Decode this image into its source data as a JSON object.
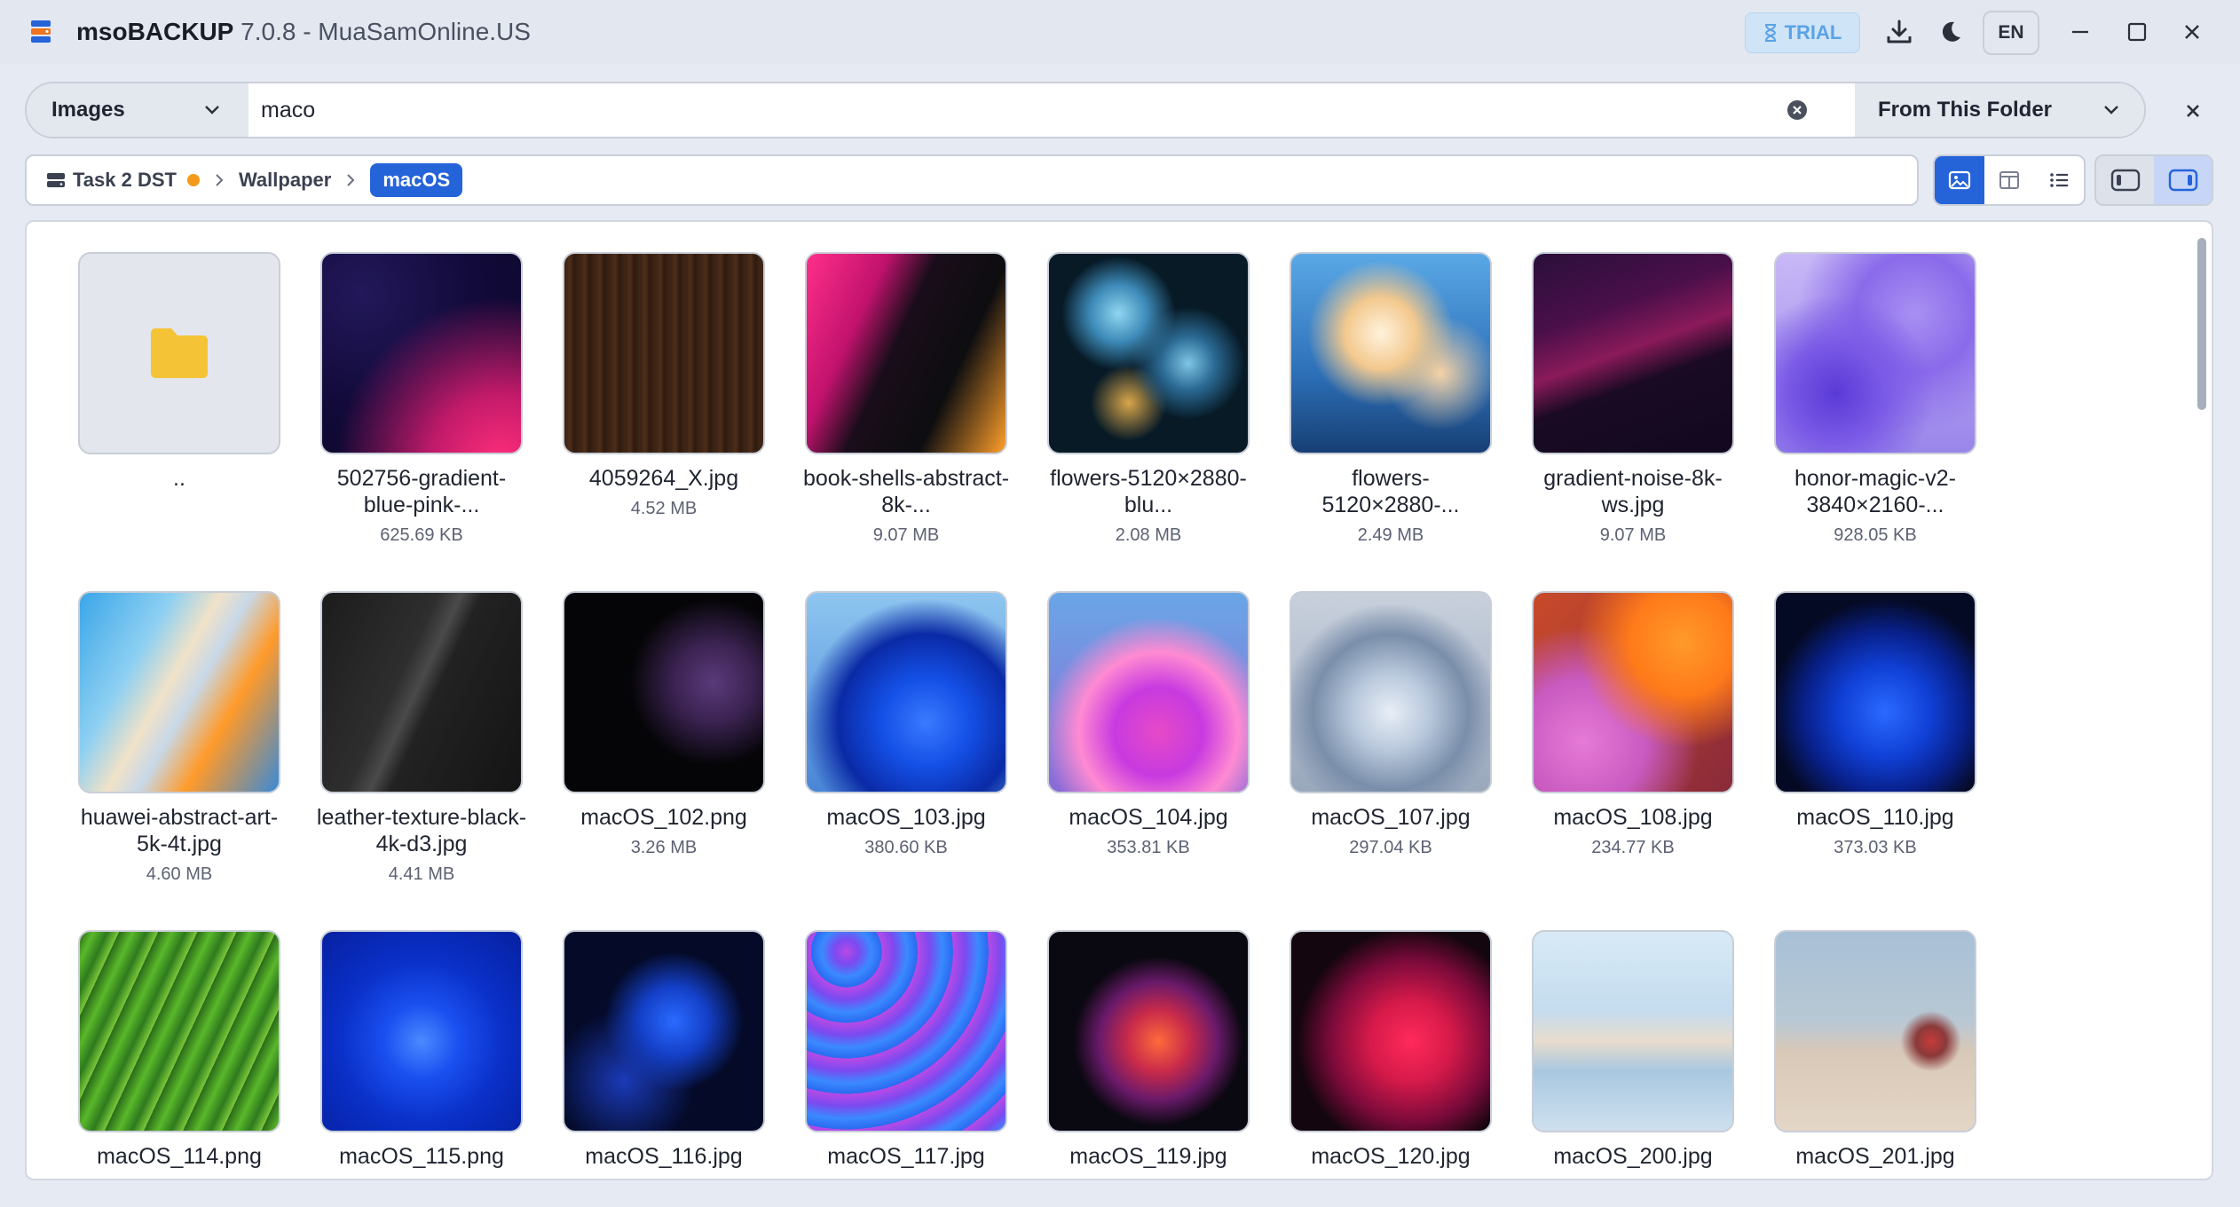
{
  "app": {
    "name": "msoBACKUP",
    "version_title": " 7.0.8 - MuaSamOnline.US",
    "trial_label": "TRIAL",
    "lang_label": "EN"
  },
  "search": {
    "type_value": "Images",
    "query": "maco",
    "scope_value": "From This Folder"
  },
  "breadcrumb": {
    "items": [
      "Task 2 DST",
      "Wallpaper"
    ],
    "current": "macOS"
  },
  "files": [
    {
      "name": "..",
      "size": ""
    },
    {
      "name": "502756-gradient-blue-pink-...",
      "size": "625.69 KB"
    },
    {
      "name": "4059264_X.jpg",
      "size": "4.52 MB"
    },
    {
      "name": "book-shells-abstract-8k-...",
      "size": "9.07 MB"
    },
    {
      "name": "flowers-5120×2880-blu...",
      "size": "2.08 MB"
    },
    {
      "name": "flowers-5120×2880-...",
      "size": "2.49 MB"
    },
    {
      "name": "gradient-noise-8k-ws.jpg",
      "size": "9.07 MB"
    },
    {
      "name": "honor-magic-v2-3840×2160-...",
      "size": "928.05 KB"
    },
    {
      "name": "huawei-abstract-art-5k-4t.jpg",
      "size": "4.60 MB"
    },
    {
      "name": "leather-texture-black-4k-d3.jpg",
      "size": "4.41 MB"
    },
    {
      "name": "macOS_102.png",
      "size": "3.26 MB"
    },
    {
      "name": "macOS_103.jpg",
      "size": "380.60 KB"
    },
    {
      "name": "macOS_104.jpg",
      "size": "353.81 KB"
    },
    {
      "name": "macOS_107.jpg",
      "size": "297.04 KB"
    },
    {
      "name": "macOS_108.jpg",
      "size": "234.77 KB"
    },
    {
      "name": "macOS_110.jpg",
      "size": "373.03 KB"
    },
    {
      "name": "macOS_114.png",
      "size": ""
    },
    {
      "name": "macOS_115.png",
      "size": ""
    },
    {
      "name": "macOS_116.jpg",
      "size": ""
    },
    {
      "name": "macOS_117.jpg",
      "size": ""
    },
    {
      "name": "macOS_119.jpg",
      "size": ""
    },
    {
      "name": "macOS_120.jpg",
      "size": ""
    },
    {
      "name": "macOS_200.jpg",
      "size": ""
    },
    {
      "name": "macOS_201.jpg",
      "size": ""
    }
  ],
  "colors": {
    "accent": "#2563d9",
    "trial": "#5aa3e6",
    "status_dot": "#f39a1d"
  }
}
